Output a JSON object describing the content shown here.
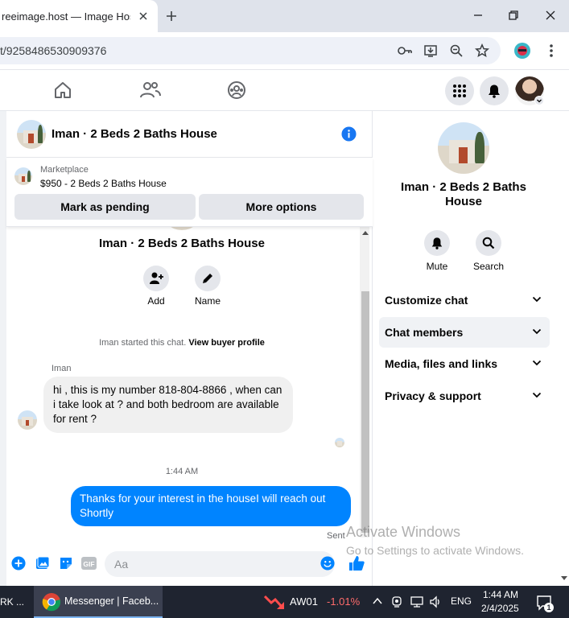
{
  "browser": {
    "tab_title": "reeimage.host — Image Hosting",
    "url": "t/9258486530909376"
  },
  "chat": {
    "title": "Iman · 2 Beds 2 Baths House",
    "marketplace_label": "Marketplace",
    "listing": "$950 - 2 Beds 2 Baths House",
    "mark_pending_label": "Mark as pending",
    "more_options_label": "More options",
    "profile_name": "Iman · 2 Beds 2 Baths House",
    "add_label": "Add",
    "name_label": "Name",
    "started_text": "Iman started this chat.",
    "view_profile_label": "View buyer profile",
    "sender_name": "Iman",
    "incoming_message": "hi , this is my number 818-804-8866 , when can i take look at ? and both bedroom are available for rent ?",
    "timestamp": "1:44 AM",
    "outgoing_message": "Thanks for your interest in the houseI will reach out Shortly",
    "status": "Sent",
    "composer_placeholder": "Aa"
  },
  "sidebar": {
    "name": "Iman · 2 Beds 2 Baths House",
    "mute_label": "Mute",
    "search_label": "Search",
    "sections": [
      {
        "label": "Customize chat"
      },
      {
        "label": "Chat members"
      },
      {
        "label": "Media, files and links"
      },
      {
        "label": "Privacy & support"
      }
    ]
  },
  "watermark": {
    "line1": "Activate Windows",
    "line2": "Go to Settings to activate Windows."
  },
  "taskbar": {
    "left_app_label": "RK ...",
    "browser_label": "Messenger | Faceb...",
    "stock_ticker": "AW01",
    "stock_change": "-1.01%",
    "language": "ENG",
    "time": "1:44 AM",
    "date": "2/4/2025",
    "notification_count": "1"
  },
  "colors": {
    "messenger_blue": "#0084ff",
    "info_blue": "#1877f2"
  }
}
